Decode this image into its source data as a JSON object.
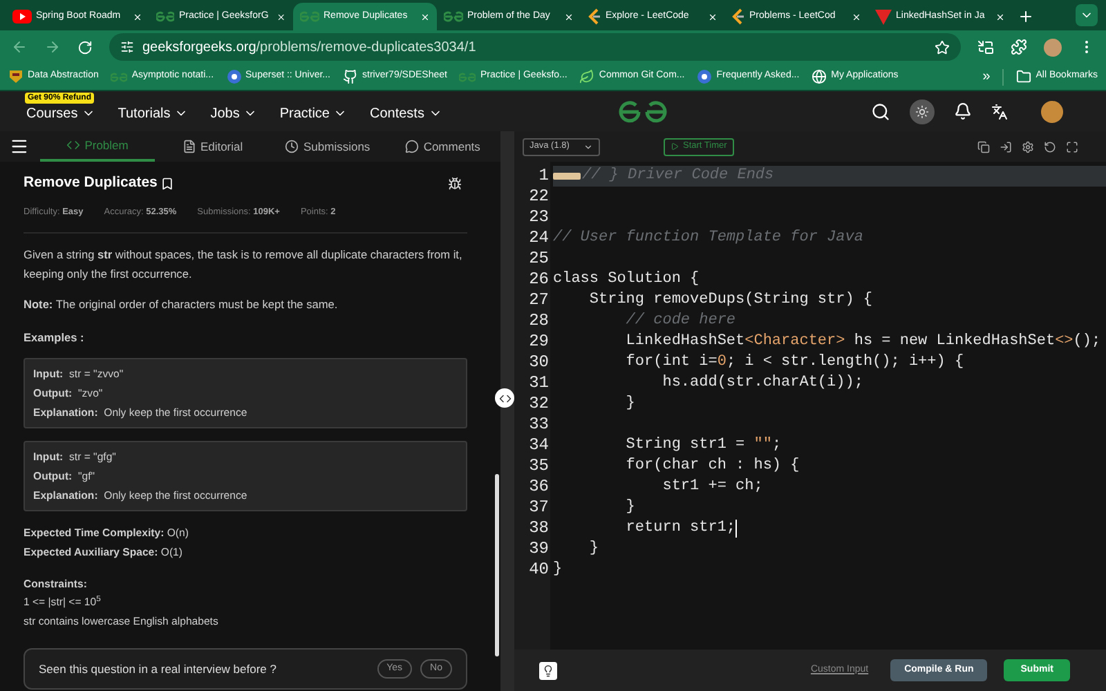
{
  "browser": {
    "tabs": [
      {
        "title": "Spring Boot Roadm",
        "selected": false,
        "kind": "youtube"
      },
      {
        "title": "Practice | GeeksforG",
        "selected": false,
        "kind": "gfg"
      },
      {
        "title": "Remove Duplicates",
        "selected": true,
        "kind": "gfg"
      },
      {
        "title": "Problem of the Day",
        "selected": false,
        "kind": "gfg"
      },
      {
        "title": "Explore - LeetCode",
        "selected": false,
        "kind": "leetcode"
      },
      {
        "title": "Problems - LeetCod",
        "selected": false,
        "kind": "leetcode"
      },
      {
        "title": "LinkedHashSet in Ja",
        "selected": false,
        "kind": "triangle"
      }
    ],
    "url_host": "geeksforgeeks.org",
    "url_path": "/problems/remove-duplicates3034/1",
    "bookmarks": [
      {
        "label": "Data Abstraction",
        "kind": "crest"
      },
      {
        "label": "Asymptotic notati...",
        "kind": "gfg"
      },
      {
        "label": "Superset :: Univer...",
        "kind": "circle"
      },
      {
        "label": "striver79/SDESheet",
        "kind": "github"
      },
      {
        "label": "Practice | Geeksfo...",
        "kind": "gfg"
      },
      {
        "label": "Common Git Com...",
        "kind": "leaf"
      },
      {
        "label": "Frequently Asked...",
        "kind": "circle"
      },
      {
        "label": "My Applications",
        "kind": "globe"
      }
    ],
    "more": "»",
    "all_bookmarks": "All Bookmarks"
  },
  "site_nav": {
    "badge": "Get 90% Refund",
    "items": [
      "Courses",
      "Tutorials",
      "Jobs",
      "Practice",
      "Contests"
    ]
  },
  "problem_tabs": [
    {
      "label": "Problem",
      "selected": true,
      "kind": "code"
    },
    {
      "label": "Editorial",
      "selected": false,
      "kind": "doc"
    },
    {
      "label": "Submissions",
      "selected": false,
      "kind": "clock"
    },
    {
      "label": "Comments",
      "selected": false,
      "kind": "chat"
    }
  ],
  "problem": {
    "title": "Remove Duplicates",
    "stats": [
      {
        "label": "Difficulty:",
        "value": "Easy"
      },
      {
        "label": "Accuracy:",
        "value": "52.35%"
      },
      {
        "label": "Submissions:",
        "value": "109K+"
      },
      {
        "label": "Points:",
        "value": "2"
      }
    ],
    "description": "Given a string **str** without spaces, the task is to remove all duplicate characters from it, keeping only the first occurrence.",
    "note": "**Note:** The original order of characters must be kept the same.",
    "examples_heading": "Examples :",
    "examples": [
      {
        "input": "Input:",
        "input_value": "str = \"zvvo\"",
        "output": "Output:",
        "output_value": "\"zvo\"",
        "explanation": "Explanation:",
        "explanation_value": "Only keep the first occurrence"
      },
      {
        "input": "Input:",
        "input_value": "str = \"gfg\"",
        "output": "Output:",
        "output_value": "\"gf\"",
        "explanation": "Explanation:",
        "explanation_value": "Only keep the first occurrence"
      }
    ],
    "complexity": [
      "**Expected Time Complexity:** O(n)",
      "**Expected Auxiliary Space:** O(1)"
    ],
    "constraints_heading": "Constraints:",
    "constraints": [
      "1 <= |str| <= 10$^{5}$",
      "str contains lowercase English alphabets"
    ],
    "interview": {
      "question": "Seen this question in a real interview before ?",
      "yes": "Yes",
      "no": "No"
    }
  },
  "editor": {
    "language": "Java (1.8)",
    "timer": "Start Timer",
    "lines": [
      {
        "number": "1",
        "active": true,
        "folded": true,
        "cursor": false,
        "tokens": [
          {
            "text": "// } Driver Code Ends",
            "kind": "comment"
          }
        ]
      },
      {
        "number": "22",
        "active": false,
        "folded": false,
        "cursor": false
      },
      {
        "number": "23",
        "active": false,
        "folded": false,
        "cursor": false
      },
      {
        "number": "24",
        "active": false,
        "folded": false,
        "cursor": false,
        "tokens": [
          {
            "text": "// User function Template for Java",
            "kind": "comment"
          }
        ]
      },
      {
        "number": "25",
        "active": false,
        "folded": false,
        "cursor": false
      },
      {
        "number": "26",
        "active": false,
        "folded": false,
        "cursor": false,
        "tokens": [
          {
            "text": "class Solution {",
            "kind": "plain"
          }
        ]
      },
      {
        "number": "27",
        "active": false,
        "folded": false,
        "cursor": false,
        "tokens": [
          {
            "text": "    String removeDups(String str) {",
            "kind": "plain"
          }
        ]
      },
      {
        "number": "28",
        "active": false,
        "folded": false,
        "cursor": false,
        "tokens": [
          {
            "text": "        // code here",
            "kind": "comment"
          }
        ]
      },
      {
        "number": "29",
        "active": false,
        "folded": false,
        "cursor": false,
        "tokens": [
          {
            "text": "        LinkedHashSet",
            "kind": "plain"
          },
          {
            "text": "<Character>",
            "kind": "generic"
          },
          {
            "text": " hs = new LinkedHashSet",
            "kind": "plain"
          },
          {
            "text": "<>",
            "kind": "generic"
          },
          {
            "text": "();",
            "kind": "plain"
          }
        ]
      },
      {
        "number": "30",
        "active": false,
        "folded": false,
        "cursor": false,
        "tokens": [
          {
            "text": "        for(int i=",
            "kind": "plain"
          },
          {
            "text": "0",
            "kind": "generic"
          },
          {
            "text": "; i < str.length(); i++) {",
            "kind": "plain"
          }
        ]
      },
      {
        "number": "31",
        "active": false,
        "folded": false,
        "cursor": false,
        "tokens": [
          {
            "text": "            hs.add(str.charAt(i));",
            "kind": "plain"
          }
        ]
      },
      {
        "number": "32",
        "active": false,
        "folded": false,
        "cursor": false,
        "tokens": [
          {
            "text": "        }",
            "kind": "plain"
          }
        ]
      },
      {
        "number": "33",
        "active": false,
        "folded": false,
        "cursor": false
      },
      {
        "number": "34",
        "active": false,
        "folded": false,
        "cursor": false,
        "tokens": [
          {
            "text": "        String str1 = ",
            "kind": "plain"
          },
          {
            "text": "\"\"",
            "kind": "generic"
          },
          {
            "text": ";",
            "kind": "plain"
          }
        ]
      },
      {
        "number": "35",
        "active": false,
        "folded": false,
        "cursor": false,
        "tokens": [
          {
            "text": "        for(char ch : hs) {",
            "kind": "plain"
          }
        ]
      },
      {
        "number": "36",
        "active": false,
        "folded": false,
        "cursor": false,
        "tokens": [
          {
            "text": "            str1 += ch;",
            "kind": "plain"
          }
        ]
      },
      {
        "number": "37",
        "active": false,
        "folded": false,
        "cursor": false,
        "tokens": [
          {
            "text": "        }",
            "kind": "plain"
          }
        ]
      },
      {
        "number": "38",
        "active": false,
        "folded": false,
        "cursor": true,
        "tokens": [
          {
            "text": "        return str1;",
            "kind": "plain"
          }
        ]
      },
      {
        "number": "39",
        "active": false,
        "folded": false,
        "cursor": false,
        "tokens": [
          {
            "text": "    }",
            "kind": "plain"
          }
        ]
      },
      {
        "number": "40",
        "active": false,
        "folded": false,
        "cursor": false,
        "tokens": [
          {
            "text": "}",
            "kind": "plain"
          }
        ]
      }
    ],
    "custom_input": "Custom Input",
    "compile": "Compile & Run",
    "submit": "Submit"
  }
}
